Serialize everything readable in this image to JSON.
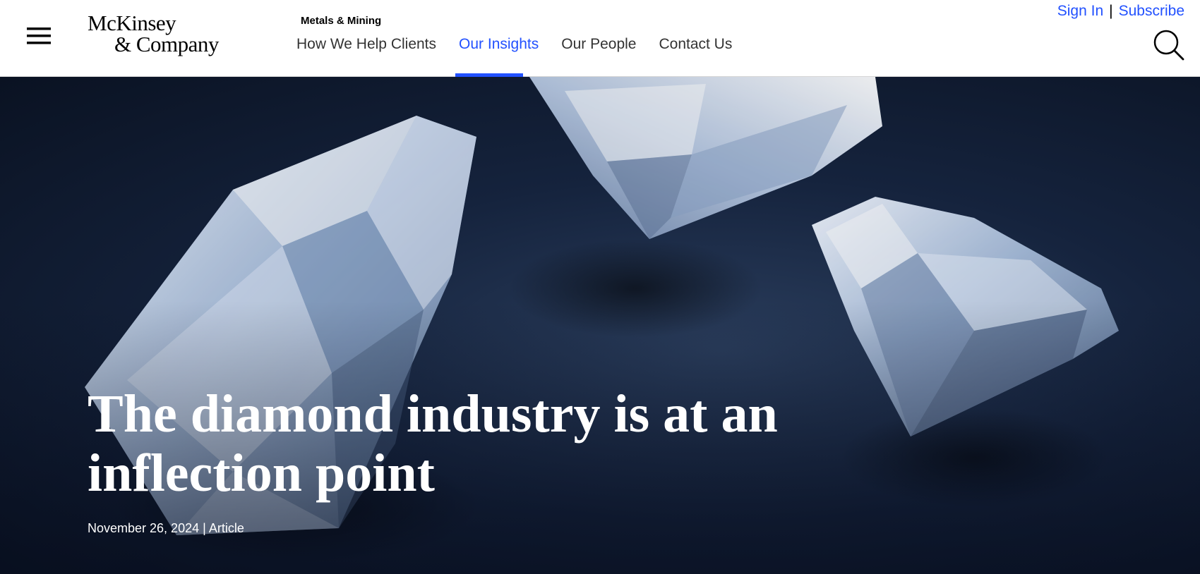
{
  "header": {
    "menu_icon": "hamburger-menu-icon",
    "logo": {
      "line1": "McKinsey",
      "line2": "& Company"
    },
    "section_label": "Metals & Mining",
    "nav": [
      {
        "label": "How We Help Clients",
        "active": false
      },
      {
        "label": "Our Insights",
        "active": true
      },
      {
        "label": "Our People",
        "active": false
      },
      {
        "label": "Contact Us",
        "active": false
      }
    ],
    "sign_in": "Sign In",
    "separator": "|",
    "subscribe": "Subscribe",
    "search_icon": "search-icon"
  },
  "hero": {
    "title": "The diamond industry is at an inflection point",
    "date": "November 26, 2024",
    "meta_separator": "|",
    "type": "Article",
    "image_subject": "diamonds-on-dark-background"
  },
  "colors": {
    "accent": "#2251ff",
    "nav_text": "#333333",
    "hero_background": "#15233d",
    "hero_text": "#ffffff"
  }
}
